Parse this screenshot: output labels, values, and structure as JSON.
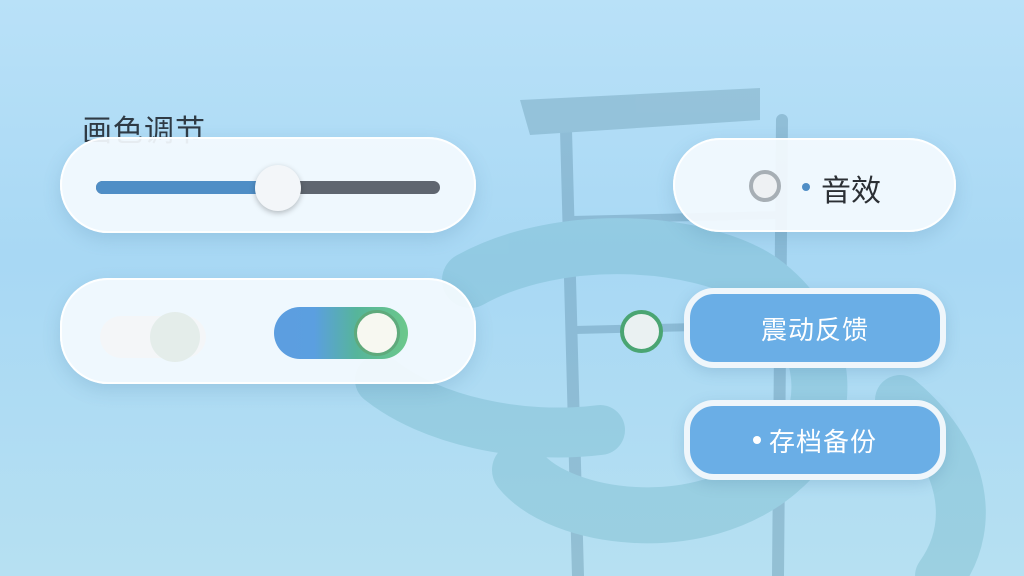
{
  "settings": {
    "section_title": "画色调节",
    "brightness_slider": {
      "value_fraction": 0.53
    },
    "toggle_primary": {
      "on": false
    },
    "toggle_secondary": {
      "on": true
    },
    "sound": {
      "label": "音效",
      "selected": false
    },
    "vibration_button": {
      "label": "震动反馈"
    },
    "save_button": {
      "label": "存档备份"
    }
  },
  "colors": {
    "accent_blue": "#4f8ec6",
    "button_blue": "#6aaee6",
    "toggle_green": "#5faa7c",
    "panel_white": "#f4fafe"
  }
}
